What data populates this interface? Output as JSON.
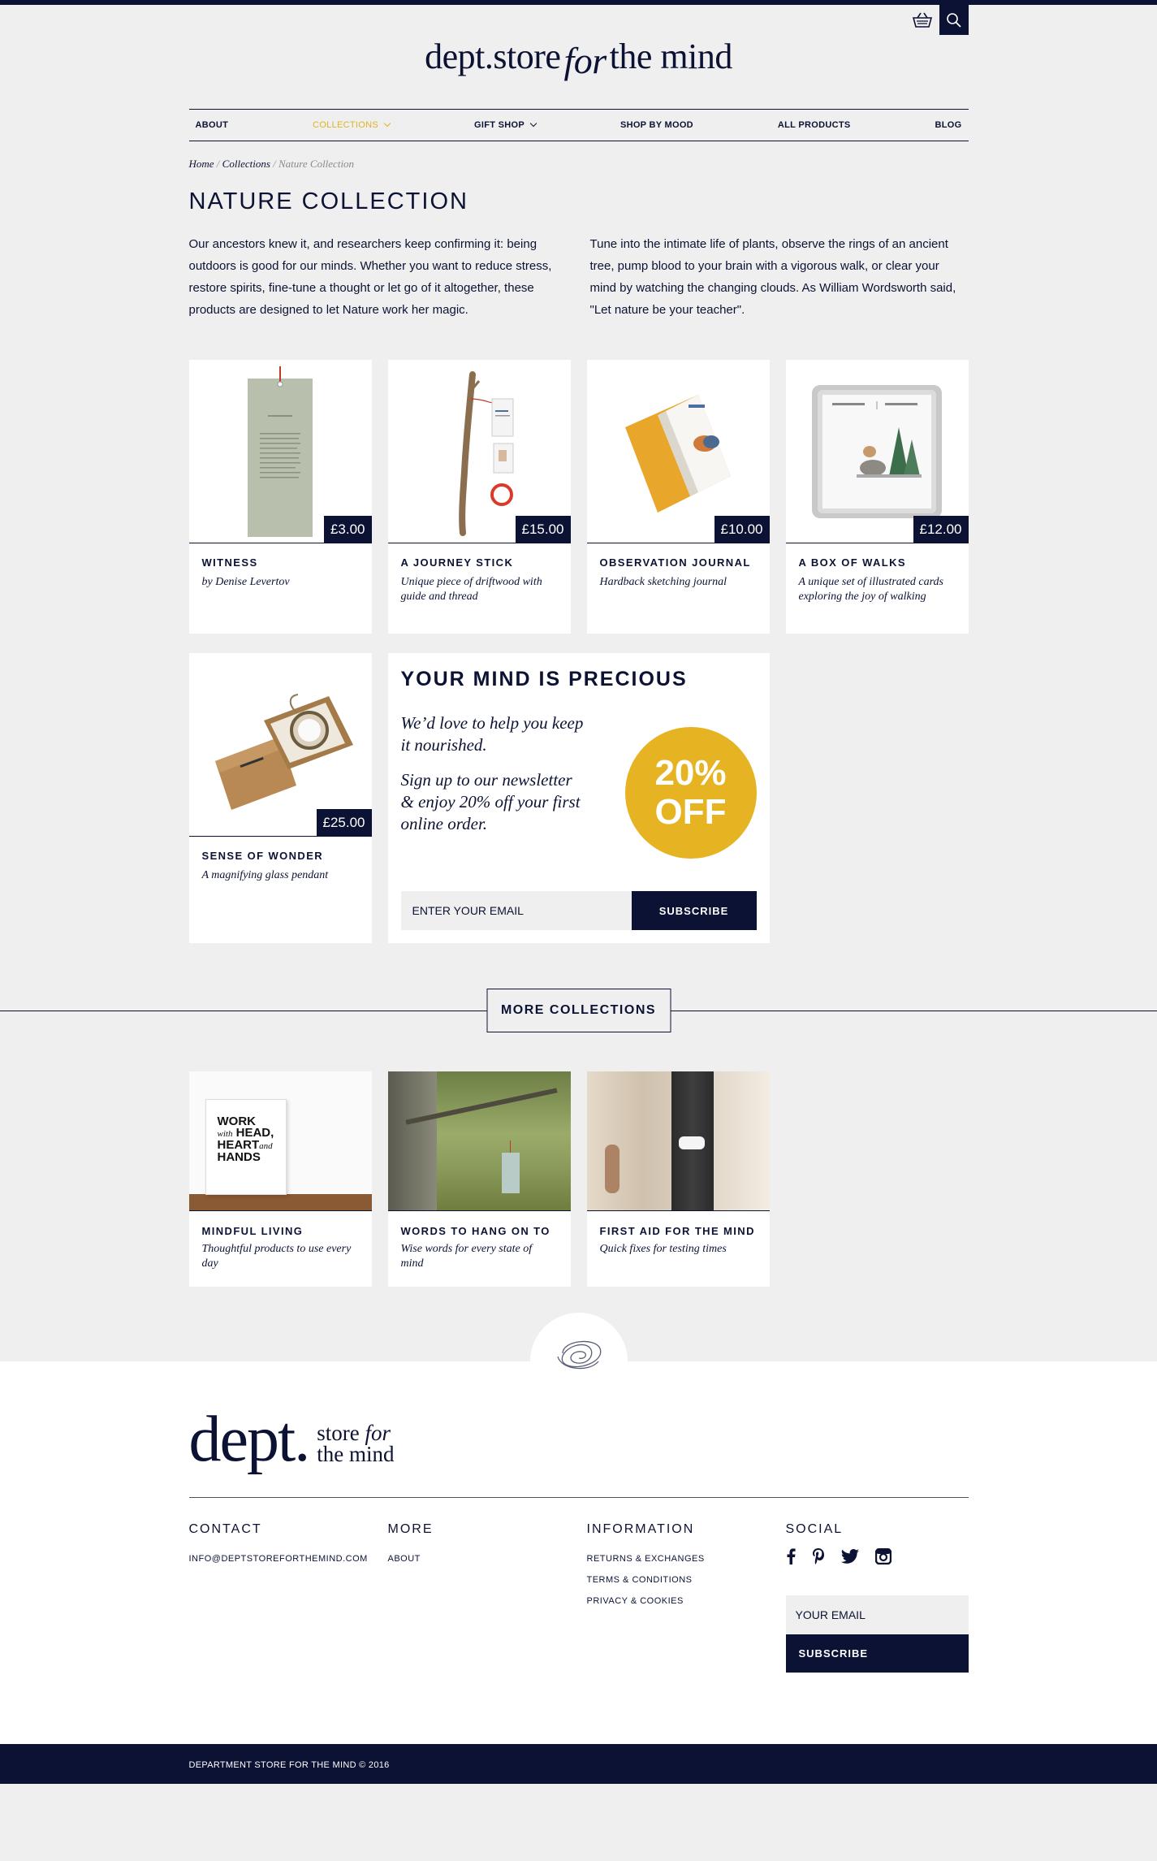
{
  "colors": {
    "navy": "#0c1233",
    "gold": "#e6b322",
    "nav_active": "#e0b224",
    "background": "#efefef"
  },
  "header": {
    "logo_main": "dept.store",
    "logo_for": "for",
    "logo_rest": "the mind",
    "icons": [
      "basket-icon",
      "search-icon"
    ]
  },
  "nav": {
    "about": "ABOUT",
    "collections": "COLLECTIONS",
    "gift_shop": "GIFT SHOP",
    "shop_by_mood": "SHOP BY MOOD",
    "all_products": "ALL PRODUCTS",
    "blog": "BLOG"
  },
  "breadcrumb": {
    "home": "Home",
    "sep": "/",
    "collections": "Collections",
    "current": "Nature Collection"
  },
  "page": {
    "title": "NATURE COLLECTION",
    "intro_left": "Our ancestors knew it, and researchers keep confirming it: being outdoors is good for our minds. Whether you want to reduce stress, restore spirits, fine-tune a thought or let go of it altogether, these products are designed to let Nature work her magic.",
    "intro_right": "Tune into the intimate life of plants, observe the rings of an ancient tree, pump blood to your brain with a vigorous walk, or clear your mind by watching the changing clouds. As William Wordsworth said, \"Let nature be your teacher\"."
  },
  "products": [
    {
      "name": "WITNESS",
      "desc": "by Denise Levertov",
      "price": "£3.00"
    },
    {
      "name": "A JOURNEY STICK",
      "desc": "Unique piece of driftwood with guide and thread",
      "price": "£15.00"
    },
    {
      "name": "OBSERVATION JOURNAL",
      "desc": "Hardback sketching journal",
      "price": "£10.00"
    },
    {
      "name": "A BOX OF WALKS",
      "desc": "A unique set of illustrated cards exploring the joy of walking",
      "price": "£12.00"
    },
    {
      "name": "SENSE OF WONDER",
      "desc": "A magnifying glass pendant",
      "price": "£25.00"
    }
  ],
  "promo": {
    "title": "YOUR MIND IS PRECIOUS",
    "line1": "We’d love to help you keep it nourished.",
    "line2": "Sign up to our newsletter & enjoy 20% off your first online order.",
    "badge_top": "20%",
    "badge_bottom": "OFF",
    "email_placeholder": "ENTER YOUR EMAIL",
    "subscribe": "SUBSCRIBE"
  },
  "more_collections": {
    "button": "MORE COLLECTIONS",
    "items": [
      {
        "name": "MINDFUL LIVING",
        "desc": "Thoughtful products to use every day"
      },
      {
        "name": "WORDS TO HANG ON TO",
        "desc": "Wise words for every state of mind"
      },
      {
        "name": "FIRST AID FOR THE MIND",
        "desc": "Quick fixes for testing times"
      }
    ],
    "poster": {
      "l1": "WORK",
      "l2a": "with",
      "l2b": "HEAD,",
      "l3a": "HEART",
      "l3b": "and",
      "l4": "HANDS"
    }
  },
  "footer": {
    "logo_big": "dept.",
    "logo_store": "store",
    "logo_for": "for",
    "logo_mind": "the mind",
    "contact": {
      "heading": "CONTACT",
      "email": "INFO@DEPTSTOREFORTHEMIND.COM"
    },
    "more": {
      "heading": "MORE",
      "about": "ABOUT"
    },
    "information": {
      "heading": "INFORMATION",
      "returns": "RETURNS & EXCHANGES",
      "terms": "TERMS & CONDITIONS",
      "privacy": "PRIVACY & COOKIES"
    },
    "social": {
      "heading": "SOCIAL",
      "icons": [
        "facebook-icon",
        "pinterest-icon",
        "twitter-icon",
        "instagram-icon"
      ]
    },
    "email_placeholder": "YOUR EMAIL",
    "subscribe": "SUBSCRIBE",
    "copyright": "DEPARTMENT STORE FOR THE MIND © 2016"
  }
}
